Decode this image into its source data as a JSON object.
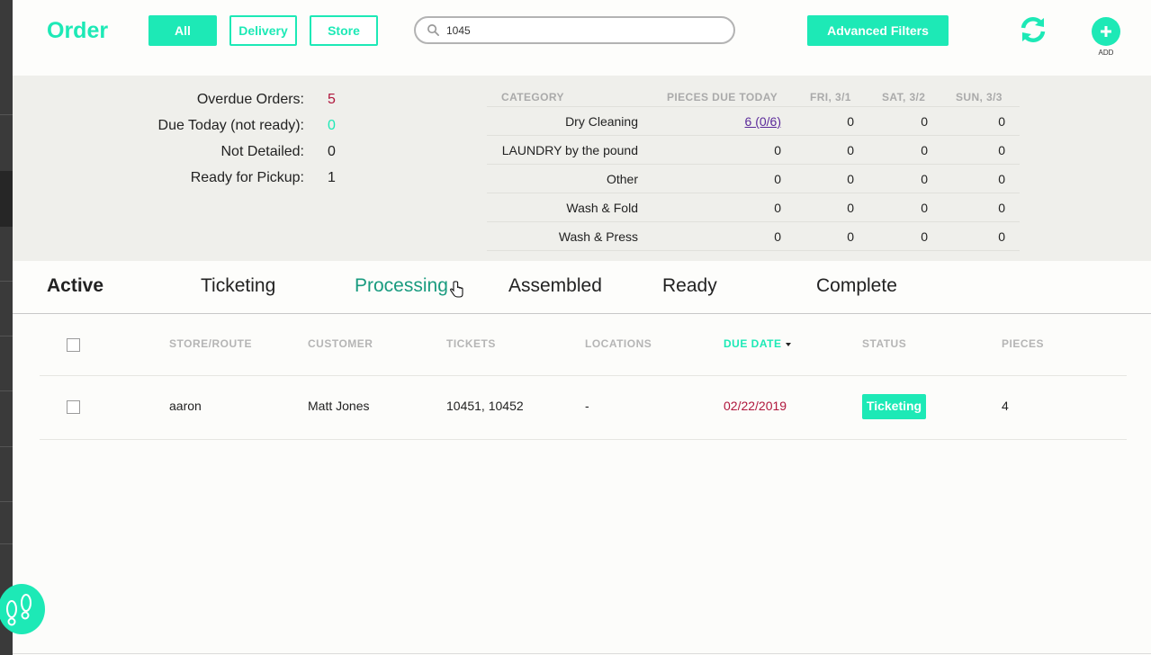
{
  "header": {
    "title": "Order",
    "filters": [
      "All",
      "Delivery",
      "Store"
    ],
    "search": {
      "value": "1045",
      "placeholder": ""
    },
    "advanced_filters_label": "Advanced Filters",
    "add_label": "ADD"
  },
  "summary": {
    "stats": [
      {
        "label": "Overdue Orders:",
        "value": "5",
        "color": "#b0173d"
      },
      {
        "label": "Due Today (not ready):",
        "value": "0",
        "color": "#1de9b6"
      },
      {
        "label": "Not Detailed:",
        "value": "0",
        "color": "#222222"
      },
      {
        "label": "Ready for Pickup:",
        "value": "1",
        "color": "#222222"
      }
    ],
    "category_table": {
      "headers": [
        "CATEGORY",
        "PIECES DUE TODAY",
        "FRI, 3/1",
        "SAT, 3/2",
        "SUN, 3/3"
      ],
      "rows": [
        [
          "Dry Cleaning",
          "6 (0/6)",
          "0",
          "0",
          "0"
        ],
        [
          "LAUNDRY by the pound",
          "0",
          "0",
          "0",
          "0"
        ],
        [
          "Other",
          "0",
          "0",
          "0",
          "0"
        ],
        [
          "Wash & Fold",
          "0",
          "0",
          "0",
          "0"
        ],
        [
          "Wash & Press",
          "0",
          "0",
          "0",
          "0"
        ]
      ]
    }
  },
  "tabs": [
    "Active",
    "Ticketing",
    "Processing",
    "Assembled",
    "Ready",
    "Complete"
  ],
  "orders": {
    "columns": [
      "STORE/ROUTE",
      "CUSTOMER",
      "TICKETS",
      "LOCATIONS",
      "DUE DATE",
      "STATUS",
      "PIECES"
    ],
    "rows": [
      {
        "store": "aaron",
        "customer": "Matt Jones",
        "tickets": "10451, 10452",
        "locations": "-",
        "due_date": "02/22/2019",
        "status": "Ticketing",
        "pieces": "4"
      }
    ]
  },
  "colors": {
    "accent": "#1de9b6",
    "overdue": "#b0173d",
    "hover_tab": "#199b7f",
    "link": "#5b2a9a"
  },
  "icons": [
    "search-icon",
    "refresh-icon",
    "plus-icon",
    "footsteps-icon",
    "pointer-cursor-icon"
  ]
}
